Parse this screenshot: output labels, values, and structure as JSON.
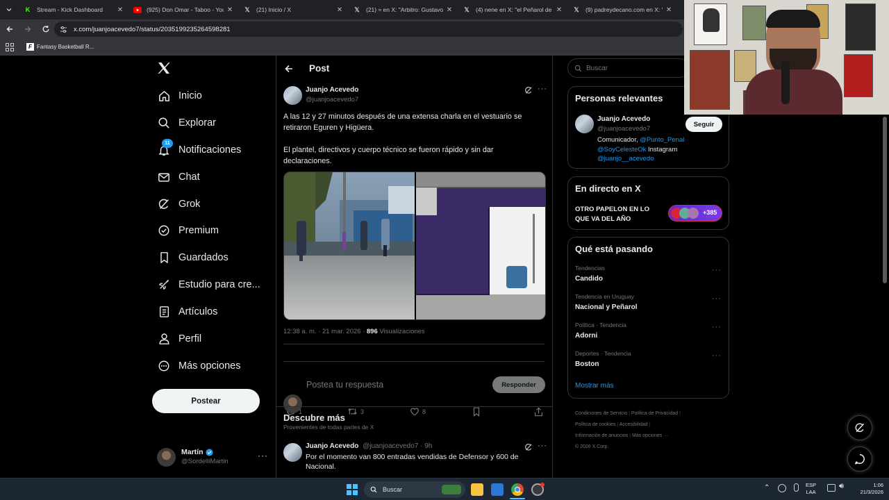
{
  "browser": {
    "tabs": [
      {
        "title": "Stream - Kick Dashboard",
        "icon": "kick-icon",
        "color": "#53fc18"
      },
      {
        "title": "(925) Don Omar - Taboo - YouT",
        "icon": "youtube-icon",
        "color": "#ff0000"
      },
      {
        "title": "(21) Inicio / X",
        "icon": "x-icon",
        "color": "#ffffff"
      },
      {
        "title": "(21) ≈ en X: \"Arbitro: Gustavo T",
        "icon": "x-icon",
        "color": "#ffffff"
      },
      {
        "title": "(4) nene en X: \"el Peñarol de D",
        "icon": "x-icon",
        "color": "#ffffff"
      },
      {
        "title": "(9) padreydecano.com en X: \"Fe",
        "icon": "x-icon",
        "color": "#ffffff"
      }
    ],
    "url": "x.com/juanjoacevedo7/status/2035199235264598281",
    "bookmark": "Fantasy Basketball R..."
  },
  "sidebar": {
    "items": [
      {
        "label": "Inicio",
        "icon": "home-icon"
      },
      {
        "label": "Explorar",
        "icon": "search-icon"
      },
      {
        "label": "Notificaciones",
        "icon": "bell-icon",
        "badge": "11"
      },
      {
        "label": "Chat",
        "icon": "mail-icon"
      },
      {
        "label": "Grok",
        "icon": "grok-icon"
      },
      {
        "label": "Premium",
        "icon": "verified-icon"
      },
      {
        "label": "Guardados",
        "icon": "bookmark-icon"
      },
      {
        "label": "Estudio para cre...",
        "icon": "rocket-icon"
      },
      {
        "label": "Artículos",
        "icon": "article-icon"
      },
      {
        "label": "Perfil",
        "icon": "person-icon"
      },
      {
        "label": "Más opciones",
        "icon": "more-circle-icon"
      }
    ],
    "post_button": "Postear",
    "account": {
      "name": "Martín",
      "handle": "@SordelliMartin"
    }
  },
  "post": {
    "header": "Post",
    "author": {
      "name": "Juanjo Acevedo",
      "handle": "@juanjoacevedo7"
    },
    "text1": "A las 12 y 27 minutos después de una extensa charla en el vestuario se retiraron Eguren y Higüera.",
    "text2": "El plantel, directivos y cuerpo técnico se fueron rápido y sin dar declaraciones.",
    "meta_time": "12:38 a. m. · 21 mar. 2026 · ",
    "views": "896",
    "views_label": " Visualizaciones",
    "replies": "1",
    "reposts": "3",
    "likes": "8",
    "reply_placeholder": "Postea tu respuesta",
    "reply_button": "Responder"
  },
  "discover": {
    "title": "Descubre más",
    "subtitle": "Provenientes de todas partes de X",
    "item": {
      "name": "Juanjo Acevedo",
      "handle": "@juanjoacevedo7 · 9h",
      "text": "Por el momento van 800 entradas vendidas de Defensor y 600 de Nacional."
    }
  },
  "right": {
    "search_placeholder": "Buscar",
    "relevant": {
      "title": "Personas relevantes",
      "name": "Juanjo Acevedo",
      "handle": "@juanjoacevedo7",
      "follow": "Seguir",
      "bio_prefix": "Comunicador, ",
      "bio_link1": "@Punto_Penal",
      "bio_link2": "@SoyCelesteOk",
      "bio_mid": " Instagram",
      "bio_link3": "@juanjo__acevedo"
    },
    "live": {
      "title": "En directo en X",
      "text": "OTRO PAPELON EN LO QUE VA DEL AÑO",
      "count": "+385"
    },
    "trending": {
      "title": "Qué está pasando",
      "items": [
        {
          "meta": "Tendencias",
          "name": "Candido"
        },
        {
          "meta": "Tendencia en Uruguay",
          "name": "Nacional y Peñarol"
        },
        {
          "meta": "Política · Tendencia",
          "name": "Adorni"
        },
        {
          "meta": "Deportes · Tendencia",
          "name": "Boston"
        }
      ],
      "show_more": "Mostrar más"
    },
    "footer": {
      "l1": "Condiciones de Servicio",
      "l2": "Política de Privacidad",
      "l3": "Política de cookies",
      "l4": "Accesibilidad",
      "l5": "Información de anuncios",
      "l6": "Más opciones ···",
      "copy": "© 2026 X Corp."
    }
  },
  "taskbar": {
    "search": "Buscar",
    "lang1": "ESP",
    "lang2": "LAA",
    "time": "1:06",
    "date": "21/3/2026"
  },
  "colors": {
    "accent": "#1d9bf0",
    "bg": "#000000",
    "border": "#2f3336",
    "muted": "#71767b"
  }
}
